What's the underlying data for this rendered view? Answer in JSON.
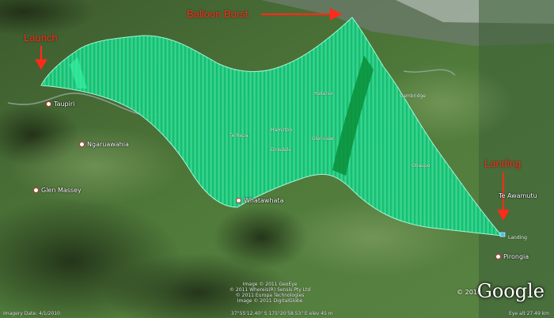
{
  "annotations": {
    "launch": "Launch",
    "burst": "Balloon Burst",
    "landing": "Landing"
  },
  "places": {
    "taupiri": "Taupiri",
    "ngaruawahia": "Ngaruawahia",
    "glen_massey": "Glen Massey",
    "whatawhata": "Whatawhata",
    "te_rapa": "Te Rapa",
    "hamilton": "Hamilton",
    "dinsdale": "Dinsdale",
    "glenview": "Glenview",
    "hukanui": "Hukanui",
    "cambridge": "Cambridge",
    "ohaupo": "Ohaupo",
    "te_awamutu": "Te Awamutu",
    "pirongia": "Pirongia",
    "landing_tag": "Landing"
  },
  "logo": {
    "name": "Google",
    "copyright": "© 2010"
  },
  "credits": {
    "line1": "Image © 2011 GeoEye",
    "line2": "© 2011 Whereis(R) Sensis Pty Ltd",
    "line3": "© 2011 Europa Technologies",
    "line4": "Image © 2011 DigitalGlobe"
  },
  "status": {
    "imagery_date": "Imagery Date: 4/1/2010",
    "coords": "37°55'12.40\" S  175°20'58.53\" E  elev  45 m",
    "eye_alt": "Eye alt  27.49 km"
  },
  "colors": {
    "track_fill": "#12c47a",
    "track_lines": "#7dffd0",
    "annotation": "#ff2a1a"
  }
}
